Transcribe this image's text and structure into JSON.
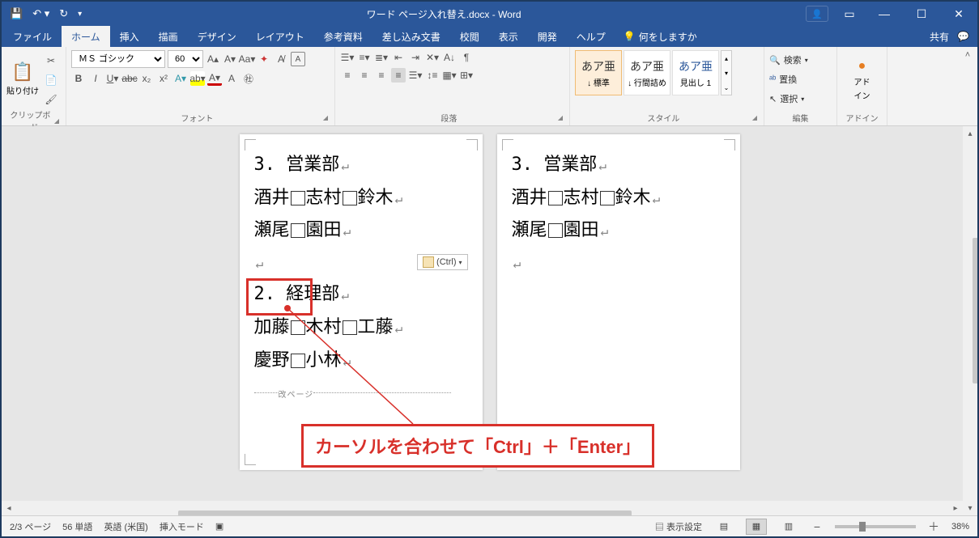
{
  "titlebar": {
    "doc_title": "ワード ページ入れ替え.docx  -  Word"
  },
  "tabs": {
    "file": "ファイル",
    "home": "ホーム",
    "insert": "挿入",
    "draw": "描画",
    "design": "デザイン",
    "layout": "レイアウト",
    "references": "参考資料",
    "mailings": "差し込み文書",
    "review": "校閲",
    "view": "表示",
    "developer": "開発",
    "help": "ヘルプ",
    "tell_me": "何をしますか",
    "share": "共有"
  },
  "ribbon": {
    "clipboard": {
      "paste": "貼り付け",
      "label": "クリップボード"
    },
    "font": {
      "name": "ＭＳ ゴシック",
      "size": "60",
      "label": "フォント"
    },
    "paragraph": {
      "label": "段落"
    },
    "styles": {
      "sample": "あア亜",
      "normal": "↓ 標準",
      "nospacing": "↓ 行間詰め",
      "heading1": "見出し 1",
      "label": "スタイル"
    },
    "editing": {
      "find": "検索",
      "replace": "置換",
      "select": "選択",
      "label": "編集"
    },
    "addins": {
      "line1": "アド",
      "line2": "イン",
      "label": "アドイン"
    }
  },
  "document": {
    "p1": {
      "l1": "3. 営業部",
      "l2a": "酒井",
      "l2b": "志村",
      "l2c": "鈴木",
      "l3a": "瀬尾",
      "l3b": "園田",
      "l5": "2. 経理部",
      "l6a": "加藤",
      "l6b": "木村",
      "l6c": "工藤",
      "l7a": "慶野",
      "l7b": "小林",
      "pagebreak": "改ページ"
    },
    "p2": {
      "l1": "3. 営業部",
      "l2a": "酒井",
      "l2b": "志村",
      "l2c": "鈴木",
      "l3a": "瀬尾",
      "l3b": "園田"
    },
    "paste_options": "(Ctrl)"
  },
  "callout": {
    "text": "カーソルを合わせて「Ctrl」＋「Enter」"
  },
  "statusbar": {
    "page": "2/3 ページ",
    "words": "56 単語",
    "lang": "英語 (米国)",
    "mode": "挿入モード",
    "display_settings": "表示設定",
    "zoom": "38%"
  }
}
